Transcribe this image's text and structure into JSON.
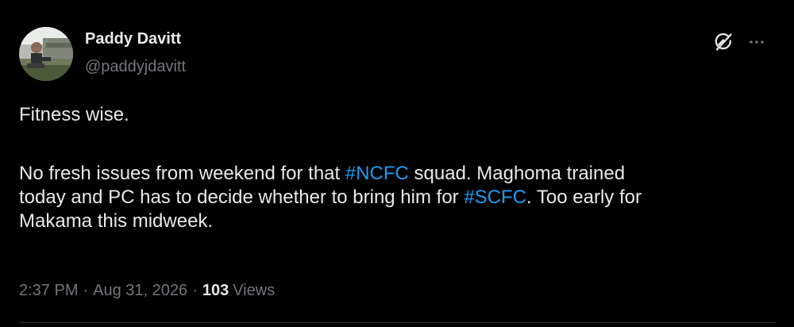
{
  "author": {
    "name": "Paddy Davitt",
    "handle": "@paddyjdavitt"
  },
  "tweet": {
    "line1": "Fitness wise.",
    "line2_a": "No fresh issues from weekend for that ",
    "hashtag1": "#NCFC",
    "line2_b": " squad. Maghoma trained",
    "line3_a": "today and PC has to decide whether to bring him for ",
    "hashtag2": "#SCFC",
    "line3_b": ". Too early for",
    "line4": "Makama this midweek."
  },
  "meta": {
    "time": "2:37 PM",
    "separator": "·",
    "date": "Aug 31, 2026",
    "views_count": "103",
    "views_label": "Views"
  },
  "icons": {
    "grok": "grok-icon",
    "more": "more-icon"
  },
  "colors": {
    "background": "#000000",
    "text": "#e7e9ea",
    "secondary": "#71767b",
    "accent": "#1d9bf0"
  }
}
